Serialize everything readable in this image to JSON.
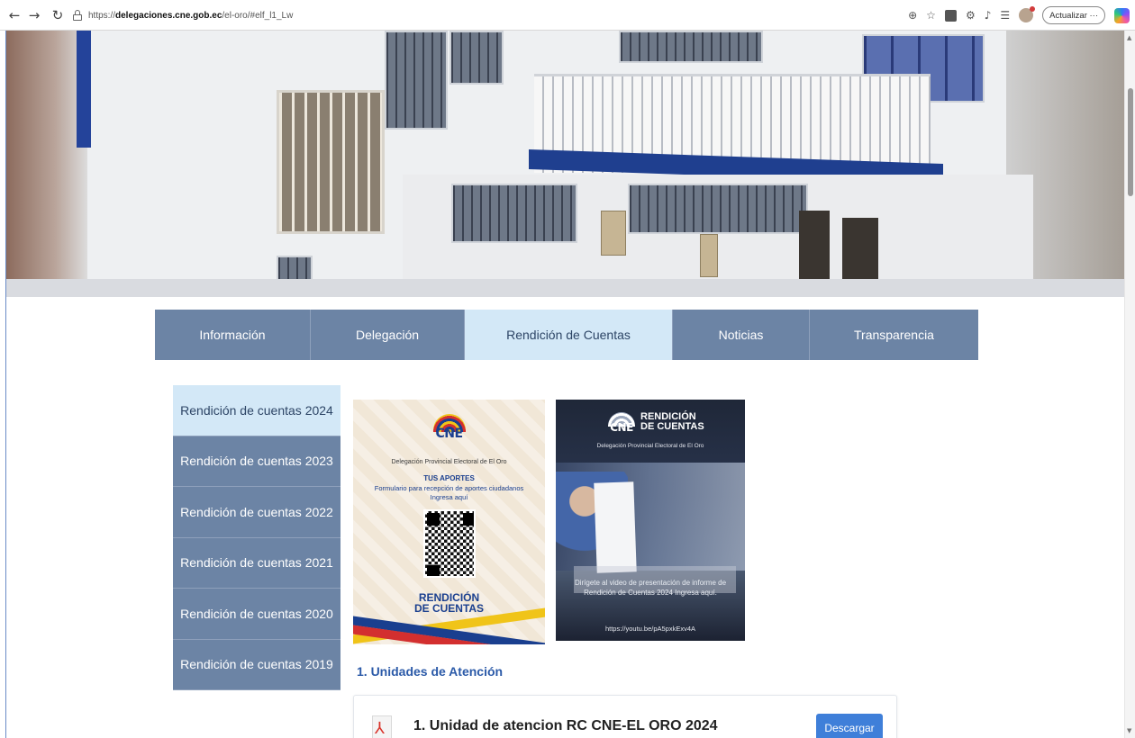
{
  "browser": {
    "url_prefix": "https://",
    "url_domain": "delegaciones.cne.gob.ec",
    "url_path": "/el-oro/#elf_l1_Lw",
    "update_label": "Actualizar",
    "more_label": "···"
  },
  "nav": {
    "items": [
      {
        "label": "Información"
      },
      {
        "label": "Delegación"
      },
      {
        "label": "Rendición de Cuentas"
      },
      {
        "label": "Noticias"
      },
      {
        "label": "Transparencia"
      }
    ],
    "active": "Rendición de Cuentas"
  },
  "sidebar": {
    "items": [
      {
        "label": "Rendición de cuentas 2024"
      },
      {
        "label": "Rendición de cuentas 2023"
      },
      {
        "label": "Rendición de cuentas 2022"
      },
      {
        "label": "Rendición de cuentas 2021"
      },
      {
        "label": "Rendición de cuentas 2020"
      },
      {
        "label": "Rendición de cuentas 2019"
      }
    ],
    "active": "Rendición de cuentas 2024"
  },
  "card_aportes": {
    "logo_text": "CNE",
    "delegation": "Delegación Provincial Electoral de El Oro",
    "title": "TUS APORTES",
    "subtitle": "Formulario para recepción de aportes ciudadanos",
    "cta": "Ingresa aquí",
    "footer_line1": "RENDICIÓN",
    "footer_line2": "DE CUENTAS"
  },
  "card_video": {
    "logo_text": "CNE",
    "heading_line1": "RENDICIÓN",
    "heading_line2": "DE CUENTAS",
    "delegation": "Delegación Provincial Electoral de El Oro",
    "caption": "Dirígete al video de presentación de informe de Rendición de Cuentas 2024 Ingresa aquí.",
    "url": "https://youtu.be/pA5pxkExv4A"
  },
  "section": {
    "title": "1. Unidades de Atención"
  },
  "document": {
    "title": "1. Unidad de atencion RC CNE-EL ORO 2024",
    "download_label": "Descargar"
  },
  "colors": {
    "nav_bg": "#6c84a5",
    "nav_active_bg": "#d3e8f7",
    "link_blue": "#2b5aa8",
    "button_blue": "#3f7fd9"
  }
}
